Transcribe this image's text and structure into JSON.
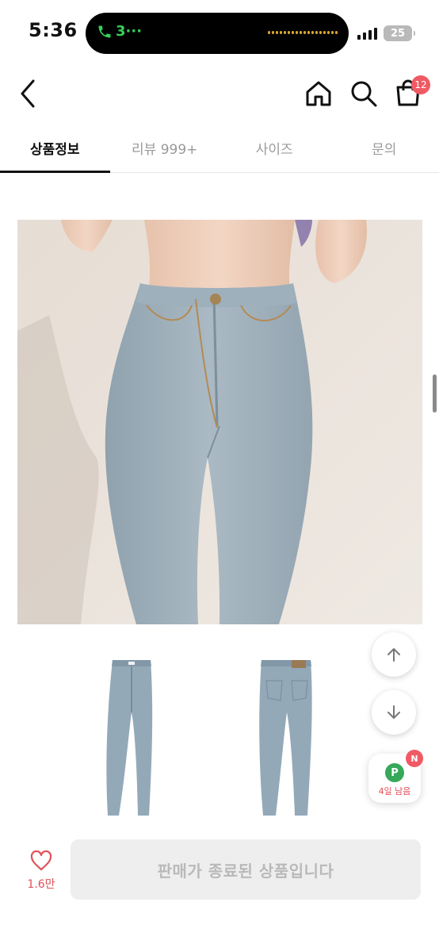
{
  "status_bar": {
    "time": "5:36",
    "call_indicator": "3···",
    "battery": "25",
    "call_color": "#35d158"
  },
  "header": {
    "icons": [
      "back-icon",
      "home-icon",
      "search-icon",
      "cart-icon"
    ],
    "cart_count": "12",
    "badge_color": "#f05a64"
  },
  "tabs": [
    {
      "label": "상품정보",
      "active": true
    },
    {
      "label": "리뷰 999+",
      "active": false
    },
    {
      "label": "사이즈",
      "active": false
    },
    {
      "label": "문의",
      "active": false
    }
  ],
  "floating": {
    "up_icon": "arrow-up-icon",
    "down_icon": "arrow-down-icon",
    "point_letter": "P",
    "point_label": "4일 남음",
    "new_badge": "N",
    "point_color": "#36a85a"
  },
  "bottom_bar": {
    "like_count": "1.6만",
    "sold_out_label": "판매가 종료된 상품입니다",
    "accent": "#e0505a"
  }
}
